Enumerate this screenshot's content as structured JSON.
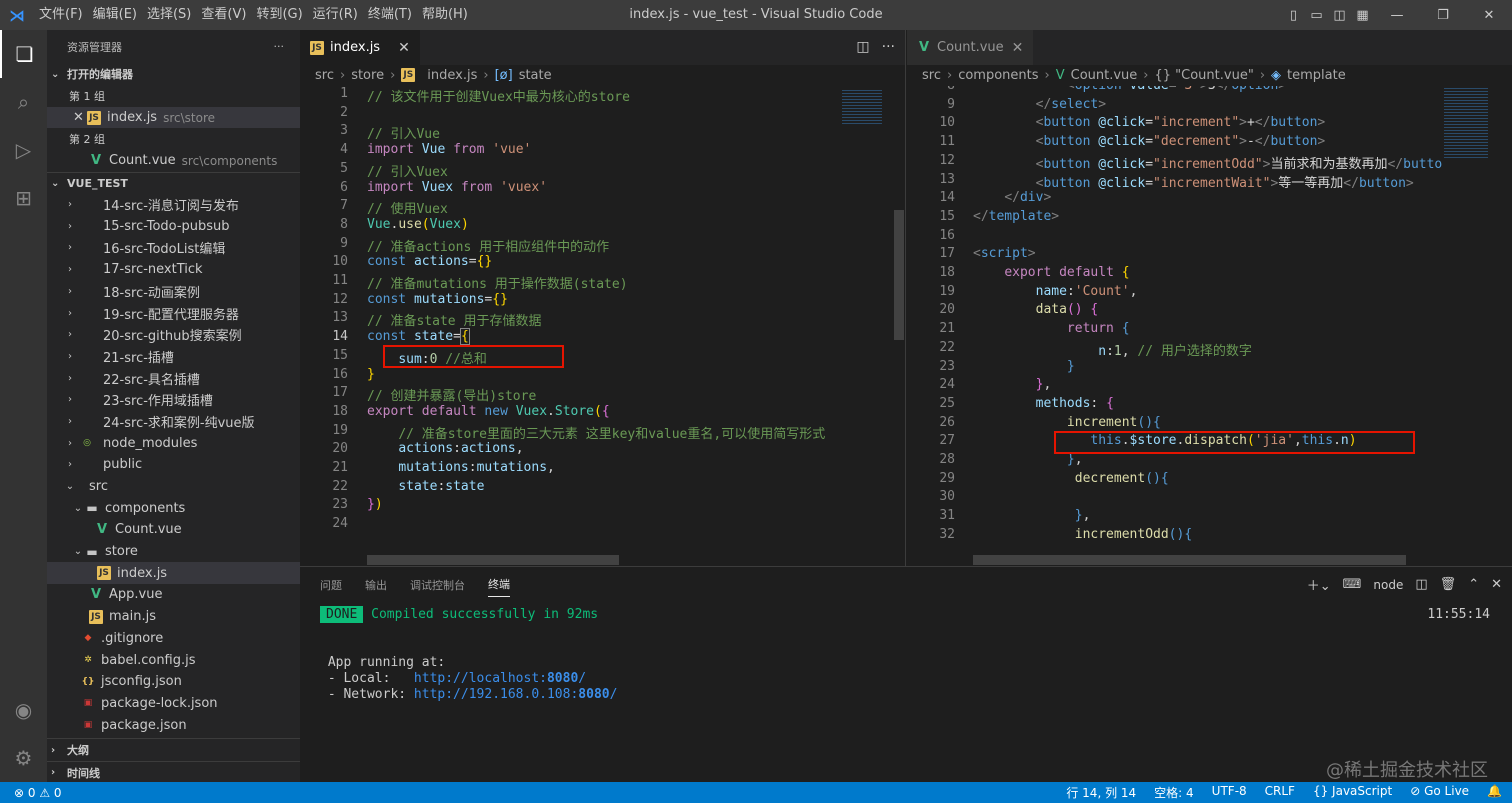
{
  "titlebar": {
    "menus": [
      "文件(F)",
      "编辑(E)",
      "选择(S)",
      "查看(V)",
      "转到(G)",
      "运行(R)",
      "终端(T)",
      "帮助(H)"
    ],
    "title": "index.js - vue_test - Visual Studio Code"
  },
  "sidebar": {
    "title": "资源管理器",
    "open_editors": "打开的编辑器",
    "group1": "第 1 组",
    "group2": "第 2 组",
    "open1": {
      "name": "index.js",
      "desc": "src\\store"
    },
    "open2": {
      "name": "Count.vue",
      "desc": "src\\components"
    },
    "project": "VUE_TEST",
    "folders": [
      "14-src-消息订阅与发布",
      "15-src-Todo-pubsub",
      "16-src-TodoList编辑",
      "17-src-nextTick",
      "18-src-动画案例",
      "19-src-配置代理服务器",
      "20-src-github搜索案例",
      "21-src-插槽",
      "22-src-具名插槽",
      "23-src-作用域插槽",
      "24-src-求和案例-纯vue版",
      "node_modules",
      "public"
    ],
    "src": "src",
    "components": "components",
    "count": "Count.vue",
    "store": "store",
    "indexjs": "index.js",
    "app": "App.vue",
    "main": "main.js",
    "rootfiles": [
      ".gitignore",
      "babel.config.js",
      "jsconfig.json",
      "package-lock.json",
      "package.json"
    ],
    "outline": "大纲",
    "timeline": "时间线"
  },
  "left_editor": {
    "tab": "index.js",
    "crumbs": [
      "src",
      "store",
      "index.js",
      "state"
    ]
  },
  "right_editor": {
    "tab": "Count.vue",
    "crumbs": [
      "src",
      "components",
      "Count.vue",
      "{} \"Count.vue\"",
      "template"
    ]
  },
  "panel": {
    "tabs": [
      "问题",
      "输出",
      "调试控制台",
      "终端"
    ],
    "shell": "node",
    "done": "DONE",
    "compiled": "Compiled successfully in 92ms",
    "time": "11:55:14",
    "running": "App running at:",
    "local_label": "- Local:   ",
    "local_url": "http://localhost:",
    "local_port": "8080",
    "local_slash": "/",
    "net_label": "- Network: ",
    "net_url": "http://192.168.0.108:",
    "net_port": "8080",
    "net_slash": "/"
  },
  "status": {
    "errors": "⊗ 0 ⚠ 0",
    "position": "行 14, 列 14",
    "spaces": "空格: 4",
    "encoding": "UTF-8",
    "eol": "CRLF",
    "language": "{} JavaScript",
    "golive": "⊘ Go Live"
  },
  "watermark": "@稀土掘金技术社区",
  "colors": {
    "accent": "#007acc",
    "redbox": "#e51400"
  }
}
